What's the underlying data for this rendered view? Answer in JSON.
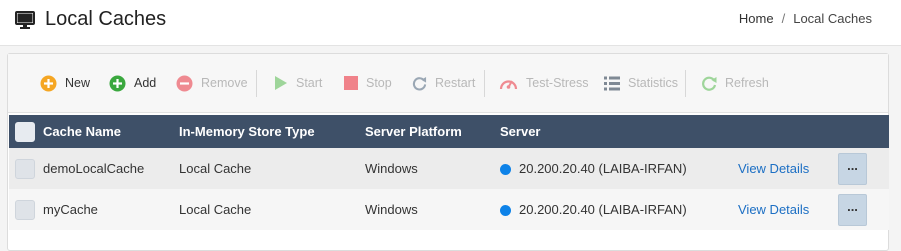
{
  "header": {
    "title": "Local Caches",
    "breadcrumb": {
      "home": "Home",
      "separator": "/",
      "current": "Local Caches"
    }
  },
  "toolbar": {
    "new_label": "New",
    "add_label": "Add",
    "remove_label": "Remove",
    "start_label": "Start",
    "stop_label": "Stop",
    "restart_label": "Restart",
    "test_stress_label": "Test-Stress",
    "statistics_label": "Statistics",
    "refresh_label": "Refresh"
  },
  "table": {
    "columns": [
      "Cache Name",
      "In-Memory Store Type",
      "Server Platform",
      "Server"
    ],
    "rows": [
      {
        "name": "demoLocalCache",
        "store_type": "Local Cache",
        "platform": "Windows",
        "server": "20.200.20.40 (LAIBA-IRFAN)",
        "details": "View Details",
        "more": "..."
      },
      {
        "name": "myCache",
        "store_type": "Local Cache",
        "platform": "Windows",
        "server": "20.200.20.40 (LAIBA-IRFAN)",
        "details": "View Details",
        "more": "..."
      }
    ]
  },
  "colors": {
    "header_bg": "#3e5068",
    "status_dot": "#0d82e8",
    "link": "#1c6fc4"
  }
}
